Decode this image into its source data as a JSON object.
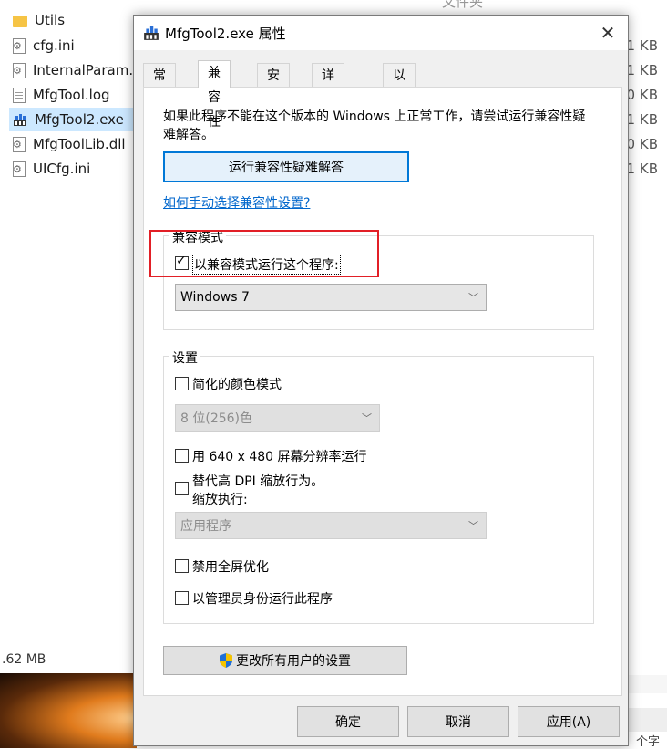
{
  "explorer": {
    "type_header": "文件夹",
    "files": [
      {
        "name": "Utils",
        "icon": "folder-icon",
        "size": ""
      },
      {
        "name": "cfg.ini",
        "icon": "ini-file-icon",
        "size": "1 KB"
      },
      {
        "name": "InternalParam.i",
        "icon": "ini-file-icon",
        "size": "1 KB"
      },
      {
        "name": "MfgTool.log",
        "icon": "text-file-icon",
        "size": "0 KB"
      },
      {
        "name": "MfgTool2.exe",
        "icon": "app-icon",
        "size": "1 KB"
      },
      {
        "name": "MfgToolLib.dll",
        "icon": "dll-file-icon",
        "size": "0 KB"
      },
      {
        "name": "UICfg.ini",
        "icon": "ini-file-icon",
        "size": "1 KB"
      }
    ],
    "status_size": ".62 MB",
    "bottom_right_text": "个字"
  },
  "dialog": {
    "title": "MfgTool2.exe 属性",
    "close_glyph": "✕",
    "tabs": [
      "常规",
      "兼容性",
      "安全",
      "详细信息",
      "以前的版本"
    ],
    "active_tab": 1,
    "intro": "如果此程序不能在这个版本的 Windows 上正常工作，请尝试运行兼容性疑难解答。",
    "run_troubleshooter": "运行兼容性疑难解答",
    "manual_link": "如何手动选择兼容性设置?",
    "compat_mode": {
      "label": "兼容模式",
      "checkbox": "以兼容模式运行这个程序:",
      "checked": true,
      "selected_os": "Windows 7"
    },
    "settings": {
      "label": "设置",
      "reduced_color": "简化的颜色模式",
      "color_value": "8 位(256)色",
      "low_res": "用 640 x 480 屏幕分辨率运行",
      "dpi_line1": "替代高 DPI 缩放行为。",
      "dpi_line2": "缩放执行:",
      "dpi_value": "应用程序",
      "disable_fullscreen": "禁用全屏优化",
      "run_as_admin": "以管理员身份运行此程序"
    },
    "change_all_users": "更改所有用户的设置",
    "buttons": {
      "ok": "确定",
      "cancel": "取消",
      "apply": "应用(A)"
    }
  },
  "colors": {
    "accent": "#0078d7",
    "highlight": "#e21f26",
    "link": "#0066cc"
  }
}
